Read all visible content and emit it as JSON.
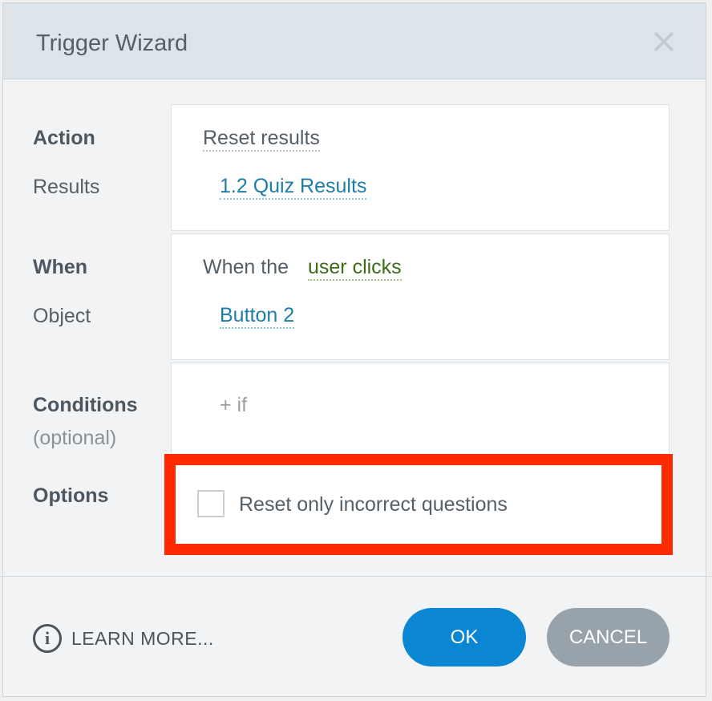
{
  "dialog": {
    "title": "Trigger Wizard",
    "close_icon": "close-icon"
  },
  "action": {
    "label": "Action",
    "value": "Reset results"
  },
  "results": {
    "label": "Results",
    "value": "1.2 Quiz Results"
  },
  "when": {
    "label": "When",
    "prefix": "When the",
    "value": "user clicks"
  },
  "object": {
    "label": "Object",
    "value": "Button 2"
  },
  "conditions": {
    "label": "Conditions",
    "sublabel": "(optional)",
    "add_label": "+ if"
  },
  "options": {
    "label": "Options",
    "checkbox_label": "Reset only incorrect questions",
    "checked": false
  },
  "footer": {
    "learn_more": "LEARN MORE...",
    "info_icon": "info-icon",
    "info_glyph": "i",
    "ok_label": "OK",
    "cancel_label": "CANCEL"
  },
  "colors": {
    "highlight_border": "#ff2a00",
    "ok_button": "#0a86d2",
    "cancel_button": "#97a2ab",
    "link_blue": "#1e7ea8",
    "link_green": "#3d6b17"
  }
}
